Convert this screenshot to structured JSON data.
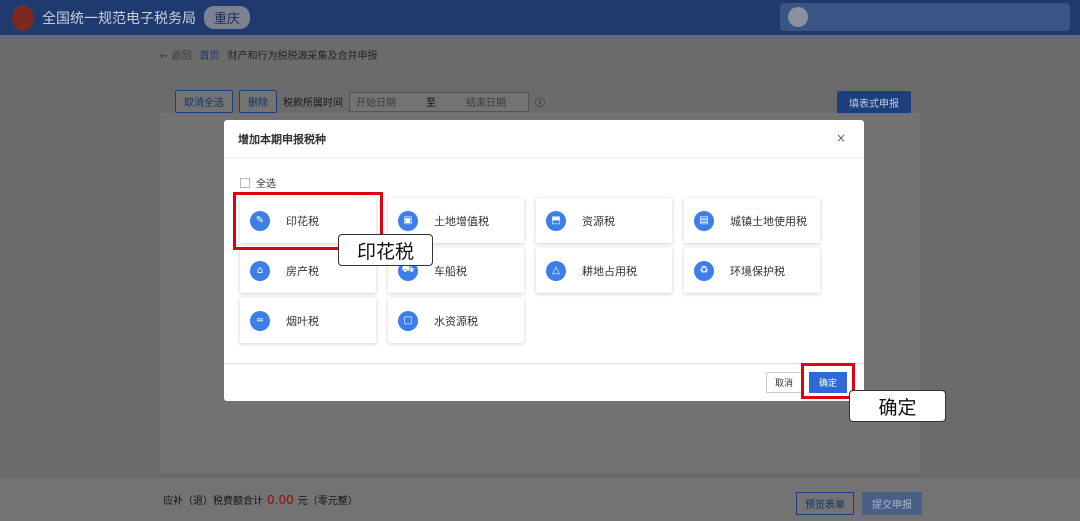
{
  "header": {
    "site": "全国统一规范电子税务局",
    "city": "重庆"
  },
  "breadcrumb": {
    "back": "← 返回",
    "home": "首页",
    "current": "财产和行为税税源采集及合并申报"
  },
  "toolbar": {
    "deselect": "取消全选",
    "delete": "删除",
    "period_label": "税款所属时间",
    "start_ph": "开始日期",
    "to": "至",
    "end_ph": "结束日期",
    "fill": "填表式申报"
  },
  "footer": {
    "label": "应补（退）税费额合计",
    "amount": "0.00",
    "unit": "元",
    "words": "（零元整）",
    "preview": "预览表单",
    "submit": "提交申报"
  },
  "modal": {
    "title": "增加本期申报税种",
    "close": "×",
    "select_all": "全选",
    "items": [
      {
        "label": "印花税"
      },
      {
        "label": "土地增值税"
      },
      {
        "label": "资源税"
      },
      {
        "label": "城镇土地使用税"
      },
      {
        "label": "房产税"
      },
      {
        "label": "车船税"
      },
      {
        "label": "耕地占用税"
      },
      {
        "label": "环境保护税"
      },
      {
        "label": "烟叶税"
      },
      {
        "label": "水资源税"
      }
    ],
    "cancel": "取消",
    "confirm": "确定"
  },
  "callouts": {
    "tax": "印花税",
    "confirm": "确定"
  }
}
